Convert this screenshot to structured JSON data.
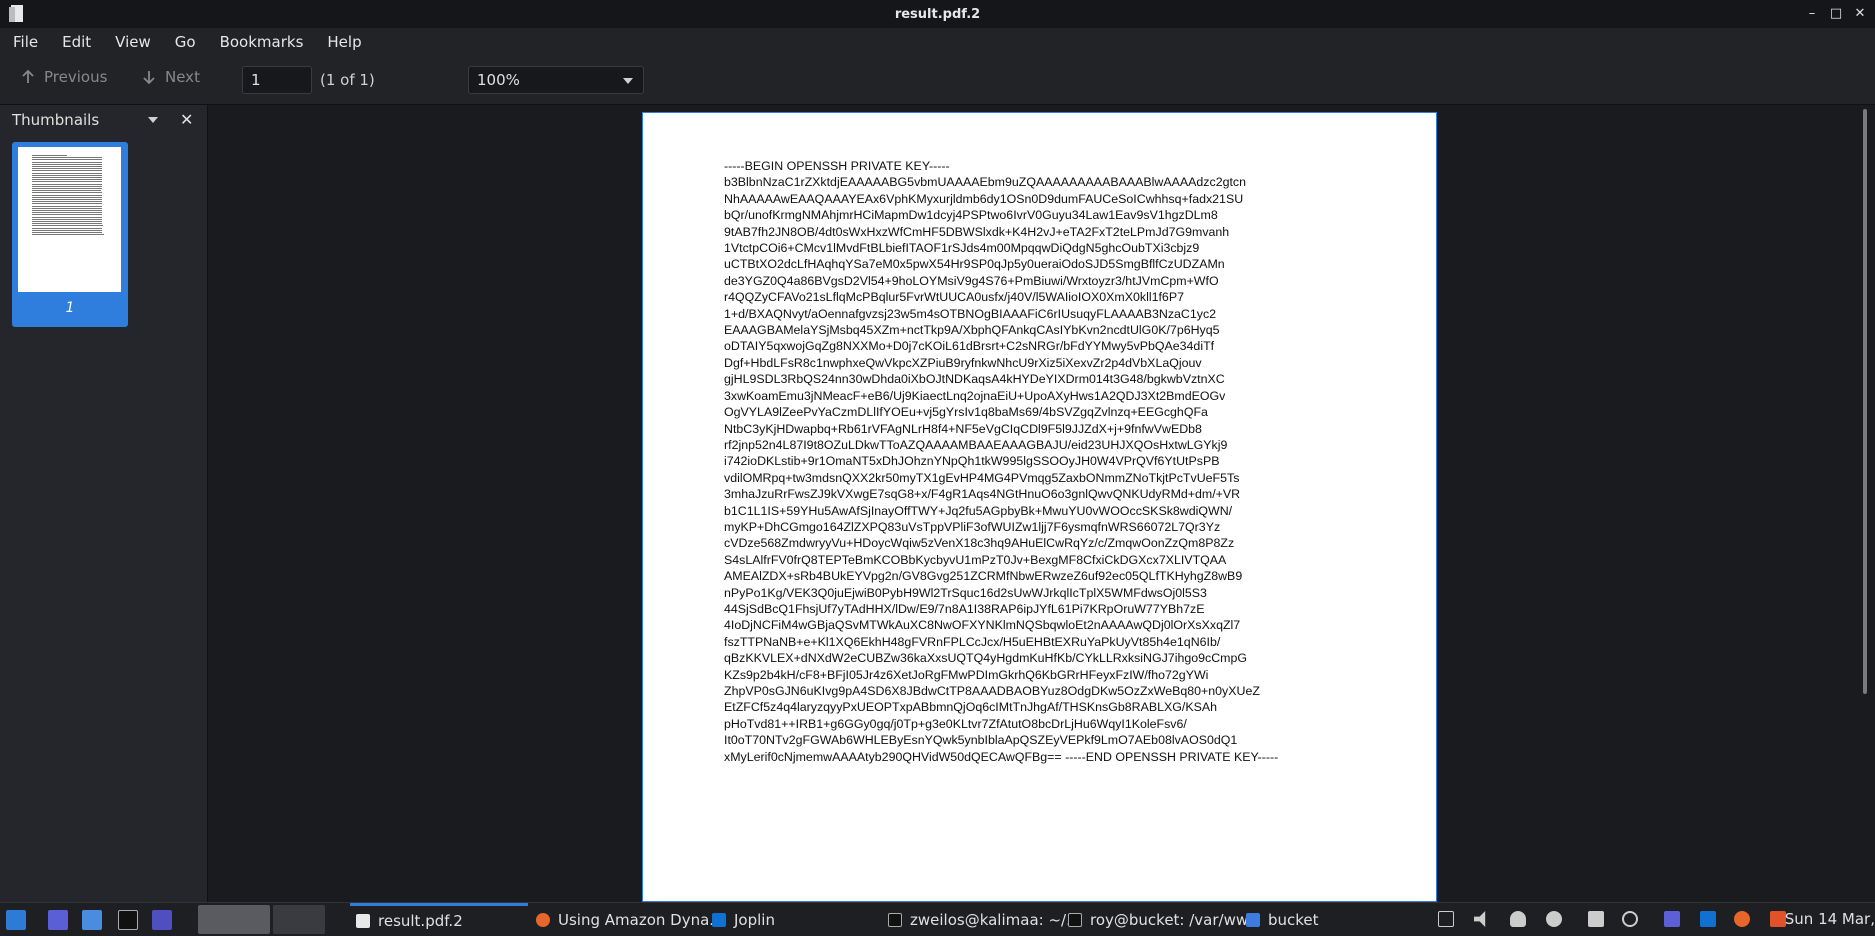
{
  "window": {
    "title": "result.pdf.2"
  },
  "menu": [
    "File",
    "Edit",
    "View",
    "Go",
    "Bookmarks",
    "Help"
  ],
  "toolbar": {
    "previous_label": "Previous",
    "next_label": "Next",
    "page_value": "1",
    "page_count": "(1 of 1)",
    "zoom_value": "100%"
  },
  "sidebar": {
    "title": "Thumbnails",
    "thumbnail_label": "1"
  },
  "document": {
    "text": "-----BEGIN OPENSSH PRIVATE KEY-----\nb3BlbnNzaC1rZXktdjEAAAAABG5vbmUAAAAEbm9uZQAAAAAAAAABAAABlwAAAAdzc2gtcn\nNhAAAAAwEAAQAAAYEAx6VphKMyxurjldmb6dy1OSn0D9dumFAUCeSoICwhhsq+fadx21SU\nbQr/unofKrmgNMAhjmrHCiMapmDw1dcyj4PSPtwo6IvrV0Guyu34Law1Eav9sV1hgzDLm8\n9tAB7fh2JN8OB/4dt0sWxHxzWfCmHF5DBWSlxdk+K4H2vJ+eTA2FxT2teLPmJd7G9mvanh\n1VtctpCOi6+CMcv1lMvdFtBLbiefITAOF1rSJds4m00MpqqwDiQdgN5ghcOubTXi3cbjz9\nuCTBtXO2dcLfHAqhqYSa7eM0x5pwX54Hr9SP0qJp5y0ueraiOdoSJD5SmgBflfCzUDZAMn\nde3YGZ0Q4a86BVgsD2Vl54+9hoLOYMsiV9g4S76+PmBiuwi/Wrxtoyzr3/htJVmCpm+WfO\nr4QQZyCFAVo21sLflqMcPBqlur5FvrWtUUCA0usfx/j40V/l5WAIioIOX0XmX0kll1f6P7\n1+d/BXAQNvyt/aOennafgvzsj23w5m4sOTBNOgBIAAAFiC6rIUsuqyFLAAAAB3NzaC1yc2\nEAAAGBAMelaYSjMsbq45XZm+nctTkp9A/XbphQFAnkqCAsIYbKvn2ncdtUlG0K/7p6Hyq5\noDTAIY5qxwojGqZg8NXXMo+D0j7cKOiL61dBrsrt+C2sNRGr/bFdYYMwy5vPbQAe34diTf\nDgf+HbdLFsR8c1nwphxeQwVkpcXZPiuB9ryfnkwNhcU9rXiz5iXexvZr2p4dVbXLaQjouv\ngjHL9SDL3RbQS24nn30wDhda0iXbOJtNDKaqsA4kHYDeYIXDrm014t3G48/bgkwbVztnXC\n3xwKoamEmu3jNMeacF+eB6/Uj9KiaectLnq2ojnaEiU+UpoAXyHws1A2QDJ3Xt2BmdEOGv\nOgVYLA9lZeePvYaCzmDLlIfYOEu+vj5gYrsIv1q8baMs69/4bSVZgqZvlnzq+EEGcghQFa\nNtbC3yKjHDwapbq+Rb61rVFAgNLrH8f4+NF5eVgCIqCDl9F5l9JJZdX+j+9fnfwVwEDb8\nrf2jnp52n4L87I9t8OZuLDkwTToAZQAAAAMBAAEAAAGBAJU/eid23UHJXQOsHxtwLGYkj9\ni742ioDKLstib+9r1OmaNT5xDhJOhznYNpQh1tkW995lgSSOOyJH0W4VPrQVf6YtUtPsPB\nvdilOMRpq+tw3mdsnQXX2kr50myTX1gEvHP4MG4PVmqg5ZaxbONmmZNoTkjtPcTvUeF5Ts\n3mhaJzuRrFwsZJ9kVXwgE7sqG8+x/F4gR1Aqs4NGtHnuO6o3gnlQwvQNKUdyRMd+dm/+VR\nb1C1L1IS+59YHu5AwAfSjInayOffTWY+Jq2fu5AGpbyBk+MwuYU0vWOOccSKSk8wdiQWN/\nmyKP+DhCGmgo164ZlZXPQ83uVsTppVPliF3ofWUIZw1ljj7F6ysmqfnWRS66072L7Qr3Yz\ncVDze568ZmdwryyVu+HDoycWqiw5zVenX18c3hq9AHuElCwRqYz/c/ZmqwOonZzQm8P8Zz\nS4sLAlfrFV0frQ8TEPTeBmKCOBbKycbyvU1mPzT0Jv+BexgMF8CfxiCkDGXcx7XLIVTQAA\nAMEAlZDX+sRb4BUkEYVpg2n/GV8Gvg251ZCRMfNbwERwzeZ6uf92ec05QLfTKHyhgZ8wB9\nnPyPo1Kg/VEK3Q0juEjwiB0PybH9Wl2TrSquc16d2sUwWJrkqlIcTplX5WMFdwsOj0l5S3\n44SjSdBcQ1FhsjUf7yTAdHHX/lDw/E9/7n8A1I38RAP6ipJYfL61Pi7KRpOruW77YBh7zE\n4IoDjNCFiM4wGBjaQSvMTWkAuXC8NwOFXYNKlmNQSbqwloEt2nAAAAwQDj0lOrXsXxqZl7\nfszTTPNaNB+e+Kl1XQ6EkhH48gFVRnFPLCcJcx/H5uEHBtEXRuYaPkUyVt85h4e1qN6Ib/\nqBzKKVLEX+dNXdW2eCUBZw36kaXxsUQTQ4yHgdmKuHfKb/CYkLLRxksiNGJ7ihgo9cCmpG\nKZs9p2b4kH/cF8+BFjI05Jr4z6XetJoRgFMwPDImGkrhQ6KbGRrHFeyxFzIW/fho72gYWi\nZhpVP0sGJN6uKIvg9pA4SD6X8JBdwCtTP8AAADBAOBYuz8OdgDKw5OzZxWeBq80+n0yXUeZ\nEtZFCf5z4q4laryzqyyPxUEOPTxpABbmnQjOq6cIMtTnJhgAf/THSKnsGb8RABLXG/KSAh\npHoTvd81++IRB1+g6GGy0gq/j0Tp+g3e0KLtvr7ZfAtutO8bcDrLjHu6WqyI1KoleFsv6/\nIt0oT70NTv2gFGWAb6WHLEByEsnYQwk5ynbIblaApQSZEyVEPkf9LmO7AEb08lvAOS0dQ1\nxMyLerif0cNjmemwAAAAtyb290QHVidW50dQECAwQFBg== -----END OPENSSH PRIVATE KEY-----"
  },
  "taskbar": {
    "tasks": [
      {
        "label": "result.pdf.2"
      },
      {
        "label": "Using Amazon Dyna..."
      },
      {
        "label": "Joplin"
      },
      {
        "label": "zweilos@kalimaa: ~/..."
      },
      {
        "label": "roy@bucket: /var/ww..."
      },
      {
        "label": "bucket"
      }
    ],
    "clock": "Sun 14 Mar,"
  }
}
